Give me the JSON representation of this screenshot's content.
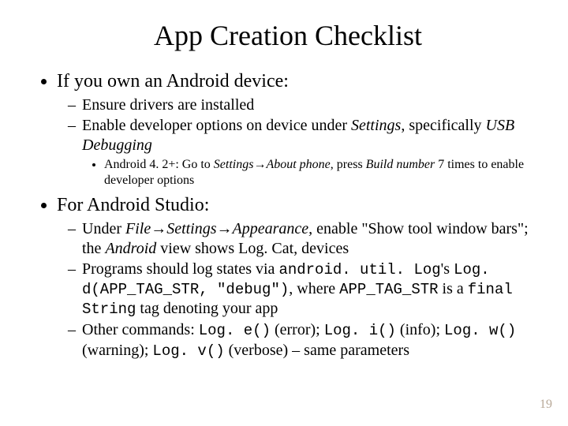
{
  "title": "App Creation Checklist",
  "bullets": {
    "item1": {
      "text": "If you own an Android device:",
      "sub1": "Ensure drivers are installed",
      "sub2_a": "Enable developer options on device under ",
      "sub2_settings": "Settings",
      "sub2_b": ", specifically ",
      "sub2_usb": "USB Debugging",
      "sub2sub_a": "Android 4. 2+: Go to ",
      "sub2sub_path": "Settings→About phone",
      "sub2sub_b": ", press ",
      "sub2sub_build": "Build number",
      "sub2sub_c": " 7 times to enable developer options"
    },
    "item2": {
      "text": "For Android Studio:",
      "sub1_a": "Under ",
      "sub1_path": "File→Settings→Appearance,",
      "sub1_b": " enable \"Show tool window bars\"; the ",
      "sub1_android": "Android",
      "sub1_c": " view shows Log. Cat, devices",
      "sub2_a": "Programs should log states via ",
      "sub2_code1": "android. util. Log",
      "sub2_b": "'s ",
      "sub2_code2": "Log. d(APP_TAG_STR, \"debug\")",
      "sub2_c": ", where ",
      "sub2_code3": "APP_TAG_STR",
      "sub2_d": " is a ",
      "sub2_code4": "final String",
      "sub2_e": " tag denoting your app",
      "sub3_a": "Other commands: ",
      "sub3_c1": "Log. e()",
      "sub3_t1": " (error); ",
      "sub3_c2": "Log. i()",
      "sub3_t2": " (info); ",
      "sub3_c3": "Log. w()",
      "sub3_t3": " (warning); ",
      "sub3_c4": "Log. v()",
      "sub3_t4": " (verbose) – same parameters"
    }
  },
  "page_number": "19"
}
